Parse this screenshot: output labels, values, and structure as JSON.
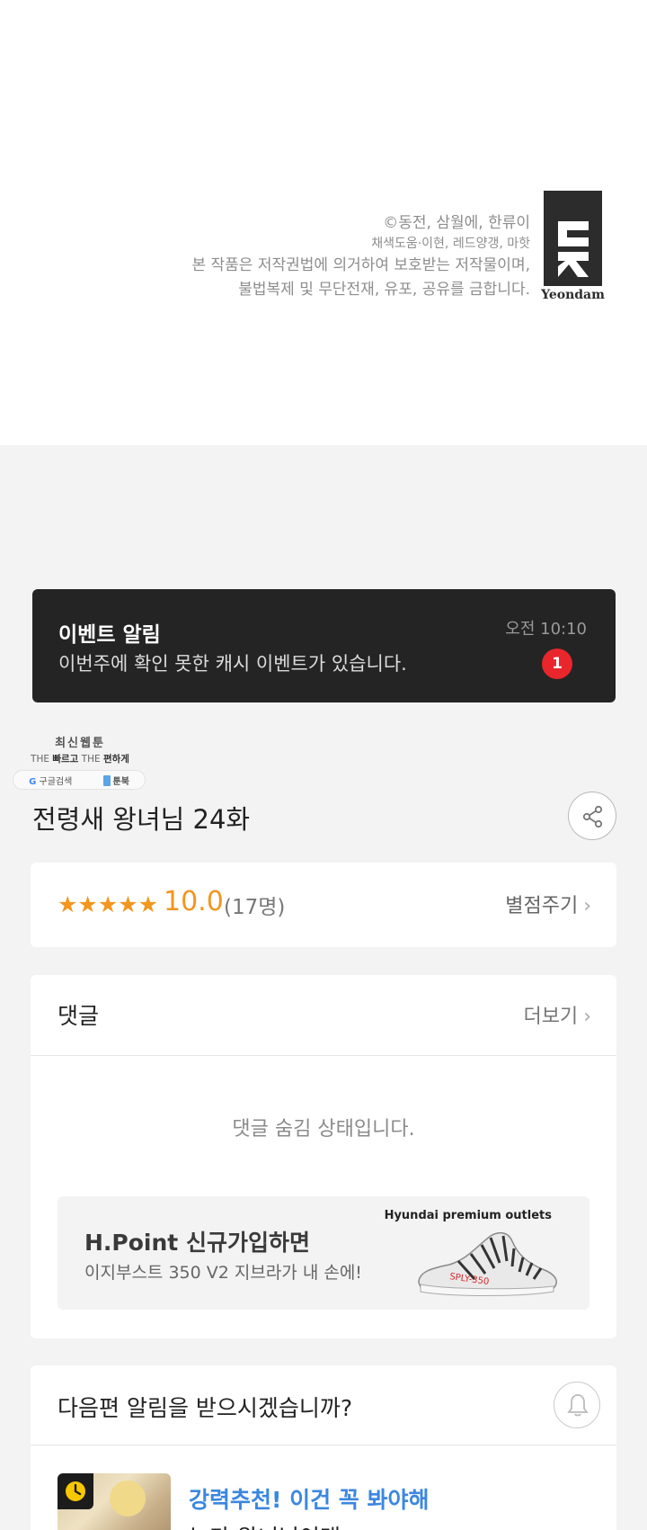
{
  "credit": {
    "line1": "©동전, 삼월에, 한류이",
    "line2": "채색도움·이현, 레드양갱, 마핫",
    "line3": "본 작품은 저작권법에 의거하여 보호받는 저작물이며,",
    "line4": "불법복제 및 무단전재, 유포, 공유를 금합니다.",
    "logo_word": "Yeondam"
  },
  "event_banner": {
    "title": "이벤트 알림",
    "message": "이번주에 확인 못한 캐시 이벤트가 있습니다.",
    "time": "오전 10:10",
    "badge_count": "1",
    "badge_color": "#e8262c"
  },
  "app_promo": {
    "line1": "최신웹툰",
    "line2_a": "THE",
    "line2_b": "빠르고",
    "line2_c": "THE",
    "line2_d": "편하게",
    "search_label": "구글검색",
    "app_label": "툰북"
  },
  "episode": {
    "title": "전령새 왕녀님 24화"
  },
  "rating": {
    "stars": "★★★★★",
    "score": "10.0",
    "count": "(17명)",
    "rate_link": "별점주기",
    "accent": "#f2961f"
  },
  "comments": {
    "header": "댓글",
    "more_link": "더보기",
    "hidden_message": "댓글 숨김 상태입니다."
  },
  "ad": {
    "title": "H.Point 신규가입하면",
    "subtitle": "이지부스트 350 V2 지브라가 내 손에!",
    "brand": "Hyundai premium outlets",
    "shoe_text": "SPLY-350"
  },
  "alert": {
    "question": "다음편 알림을 받으시겠습니까?",
    "recommend_label": "강력추천! 이건 꼭 봐야해",
    "next_title": "누가 왕녀님이래",
    "accent": "#3b87e0"
  }
}
